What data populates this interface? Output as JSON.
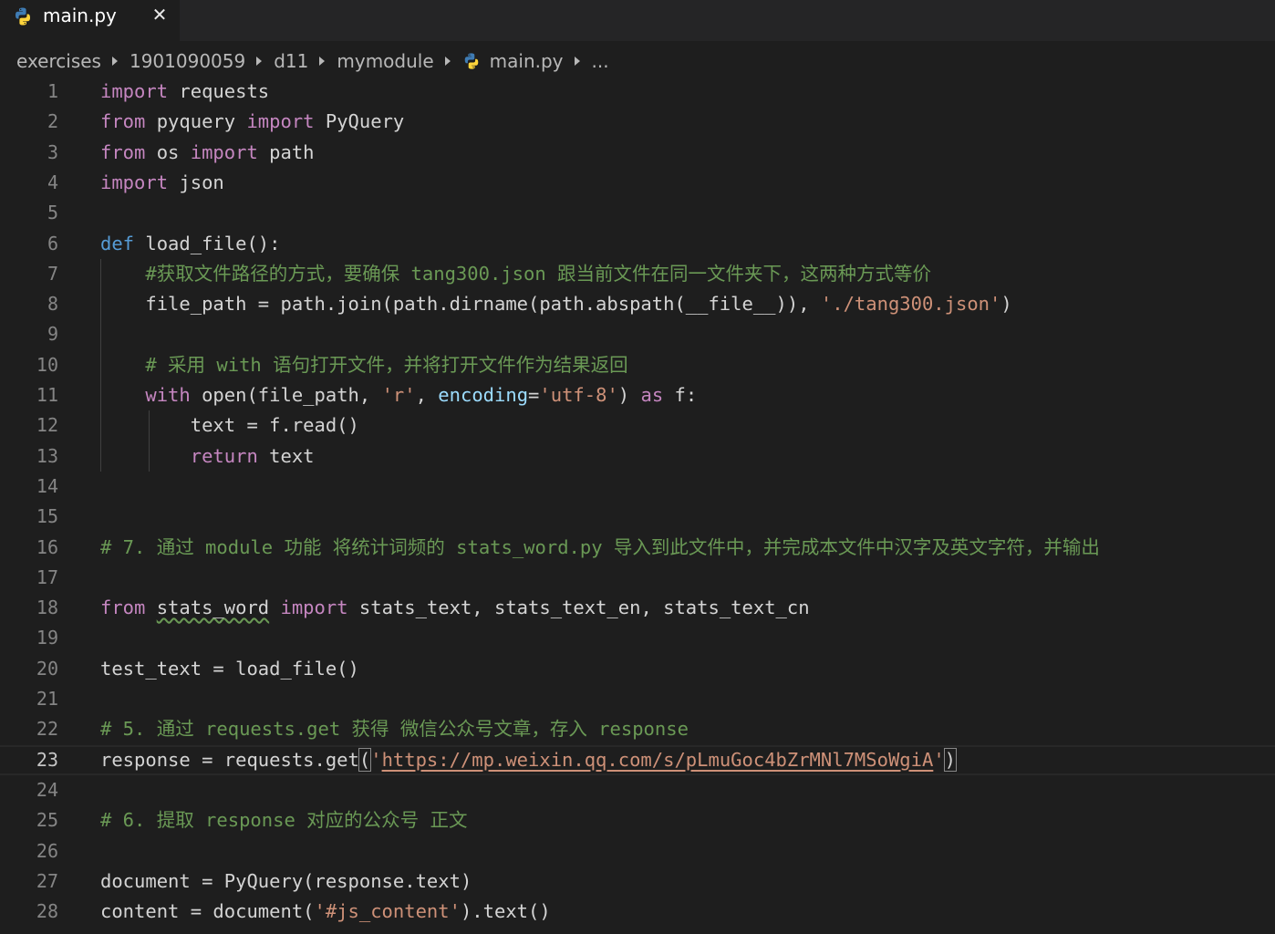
{
  "tab": {
    "icon": "python-icon",
    "label": "main.py",
    "close_glyph": "✕"
  },
  "breadcrumb": {
    "items": [
      "exercises",
      "1901090059",
      "d11",
      "mymodule"
    ],
    "file_icon": "python-icon",
    "file": "main.py",
    "more": "..."
  },
  "editor": {
    "current_line": 23,
    "lines": [
      {
        "n": "1",
        "tokens": [
          {
            "t": "import",
            "c": "kw"
          },
          {
            "t": " requests",
            "c": "pl"
          }
        ]
      },
      {
        "n": "2",
        "tokens": [
          {
            "t": "from",
            "c": "kw"
          },
          {
            "t": " pyquery ",
            "c": "pl"
          },
          {
            "t": "import",
            "c": "kw"
          },
          {
            "t": " PyQuery",
            "c": "pl"
          }
        ]
      },
      {
        "n": "3",
        "tokens": [
          {
            "t": "from",
            "c": "kw"
          },
          {
            "t": " os ",
            "c": "pl"
          },
          {
            "t": "import",
            "c": "kw"
          },
          {
            "t": " path",
            "c": "pl"
          }
        ]
      },
      {
        "n": "4",
        "tokens": [
          {
            "t": "import",
            "c": "kw"
          },
          {
            "t": " json",
            "c": "pl"
          }
        ]
      },
      {
        "n": "5",
        "tokens": []
      },
      {
        "n": "6",
        "tokens": [
          {
            "t": "def",
            "c": "def"
          },
          {
            "t": " load_file():",
            "c": "pl"
          }
        ]
      },
      {
        "n": "7",
        "tokens": [
          {
            "t": "    #获取文件路径的方式，要确保 tang300.json 跟当前文件在同一文件夹下，这两种方式等价",
            "c": "cm"
          }
        ]
      },
      {
        "n": "8",
        "tokens": [
          {
            "t": "    file_path = path.join(path.dirname(path.abspath(__file__)), ",
            "c": "pl"
          },
          {
            "t": "'./tang300.json'",
            "c": "str"
          },
          {
            "t": ")",
            "c": "pl"
          }
        ]
      },
      {
        "n": "9",
        "tokens": []
      },
      {
        "n": "10",
        "tokens": [
          {
            "t": "    # 采用 with 语句打开文件，并将打开文件作为结果返回",
            "c": "cm"
          }
        ]
      },
      {
        "n": "11",
        "tokens": [
          {
            "t": "    ",
            "c": "pl"
          },
          {
            "t": "with",
            "c": "kw"
          },
          {
            "t": " open(file_path, ",
            "c": "pl"
          },
          {
            "t": "'r'",
            "c": "str"
          },
          {
            "t": ", ",
            "c": "pl"
          },
          {
            "t": "encoding",
            "c": "var"
          },
          {
            "t": "=",
            "c": "pl"
          },
          {
            "t": "'utf-8'",
            "c": "str"
          },
          {
            "t": ") ",
            "c": "pl"
          },
          {
            "t": "as",
            "c": "kw"
          },
          {
            "t": " f:",
            "c": "pl"
          }
        ]
      },
      {
        "n": "12",
        "tokens": [
          {
            "t": "        text = f.read()",
            "c": "pl"
          }
        ]
      },
      {
        "n": "13",
        "tokens": [
          {
            "t": "        ",
            "c": "pl"
          },
          {
            "t": "return",
            "c": "kw"
          },
          {
            "t": " text",
            "c": "pl"
          }
        ]
      },
      {
        "n": "14",
        "tokens": []
      },
      {
        "n": "15",
        "tokens": []
      },
      {
        "n": "16",
        "tokens": [
          {
            "t": "# 7. 通过 module 功能 将统计词频的 stats_word.py 导入到此文件中，并完成本文件中汉字及英文字符，并输出",
            "c": "cm"
          }
        ]
      },
      {
        "n": "17",
        "tokens": []
      },
      {
        "n": "18",
        "tokens": [
          {
            "t": "from",
            "c": "kw"
          },
          {
            "t": " ",
            "c": "pl"
          },
          {
            "t": "stats_word",
            "c": "pl",
            "deco": "squig"
          },
          {
            "t": " ",
            "c": "pl"
          },
          {
            "t": "import",
            "c": "kw"
          },
          {
            "t": " stats_text, stats_text_en, stats_text_cn",
            "c": "pl"
          }
        ]
      },
      {
        "n": "19",
        "tokens": []
      },
      {
        "n": "20",
        "tokens": [
          {
            "t": "test_text = load_file()",
            "c": "pl"
          }
        ]
      },
      {
        "n": "21",
        "tokens": []
      },
      {
        "n": "22",
        "tokens": [
          {
            "t": "# 5. 通过 requests.get 获得 微信公众号文章，存入 response",
            "c": "cm"
          }
        ]
      },
      {
        "n": "23",
        "tokens": [
          {
            "t": "response = requests.get",
            "c": "pl"
          },
          {
            "t": "(",
            "c": "pl",
            "deco": "bracket-box"
          },
          {
            "t": "'",
            "c": "str"
          },
          {
            "t": "https://mp.weixin.qq.com/s/pLmuGoc4bZrMNl7MSoWgiA",
            "c": "str",
            "deco": "link-u"
          },
          {
            "t": "'",
            "c": "str"
          },
          {
            "t": ")",
            "c": "pl",
            "deco": "bracket-box"
          }
        ]
      },
      {
        "n": "24",
        "tokens": []
      },
      {
        "n": "25",
        "tokens": [
          {
            "t": "# 6. 提取 response 对应的公众号 正文",
            "c": "cm"
          }
        ]
      },
      {
        "n": "26",
        "tokens": []
      },
      {
        "n": "27",
        "tokens": [
          {
            "t": "document = PyQuery(response.text)",
            "c": "pl"
          }
        ]
      },
      {
        "n": "28",
        "tokens": [
          {
            "t": "content = document(",
            "c": "pl"
          },
          {
            "t": "'#js_content'",
            "c": "str"
          },
          {
            "t": ").text()",
            "c": "pl"
          }
        ]
      }
    ]
  },
  "colors": {
    "background": "#1e1e1e",
    "keyword": "#c586c0",
    "def_keyword": "#569cd6",
    "string": "#ce9178",
    "comment": "#6a9955",
    "parameter": "#9cdcfe",
    "plain": "#d4d4d4",
    "python_blue": "#3f7cb4",
    "python_yellow": "#ffd43b"
  }
}
